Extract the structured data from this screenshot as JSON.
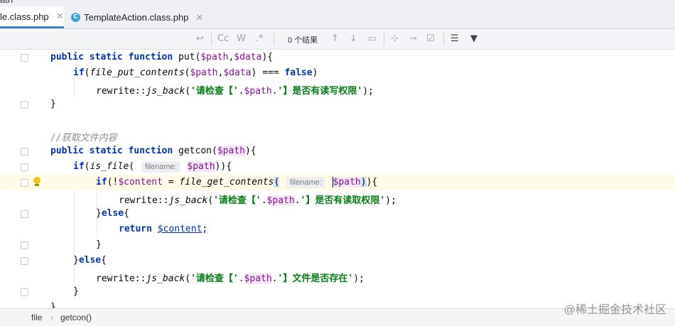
{
  "window": {
    "title_fragment": "ath"
  },
  "tabs": [
    {
      "label": "le.class.php",
      "active": true
    },
    {
      "label": "TemplateAction.class.php",
      "active": false,
      "icon": "C"
    }
  ],
  "find_toolbar": {
    "match_case": "Cc",
    "words": "W",
    "regex": ".*",
    "result_text": "0 个结果"
  },
  "code_lines": [
    {
      "t": "public static function put($path,$data){"
    },
    {
      "t": "if(file_put_contents($path,$data) === false)"
    },
    {
      "t": "rewrite::js_back('请检查【'.$path.'】是否有读写权限');"
    },
    {
      "t": "}"
    },
    {
      "t": ""
    },
    {
      "t": "//获取文件内容"
    },
    {
      "t": "public static function getcon($path){"
    },
    {
      "t": "if(is_file(",
      "hint": "filename:",
      "t2": "$path)){"
    },
    {
      "t": "if(!$content = file_get_contents(",
      "hint": "filename:",
      "t2": "$path)){"
    },
    {
      "t": "rewrite::js_back('请检查【'.$path.'】是否有读取权限');"
    },
    {
      "t": "}else{"
    },
    {
      "t": "return $content;"
    },
    {
      "t": "}"
    },
    {
      "t": "}else{"
    },
    {
      "t": "rewrite::js_back('请检查【'.$path.'】文件是否存在');"
    },
    {
      "t": "}"
    },
    {
      "t": "}"
    }
  ],
  "breadcrumb": {
    "item1": "file",
    "separator": "›",
    "item2": "getcon()"
  },
  "watermark": "@稀土掘金技术社区",
  "colors": {
    "keyword": "#0033b3",
    "variable": "#871094",
    "string": "#067d17",
    "comment": "#8c8c8c",
    "accent": "#4083c9"
  }
}
